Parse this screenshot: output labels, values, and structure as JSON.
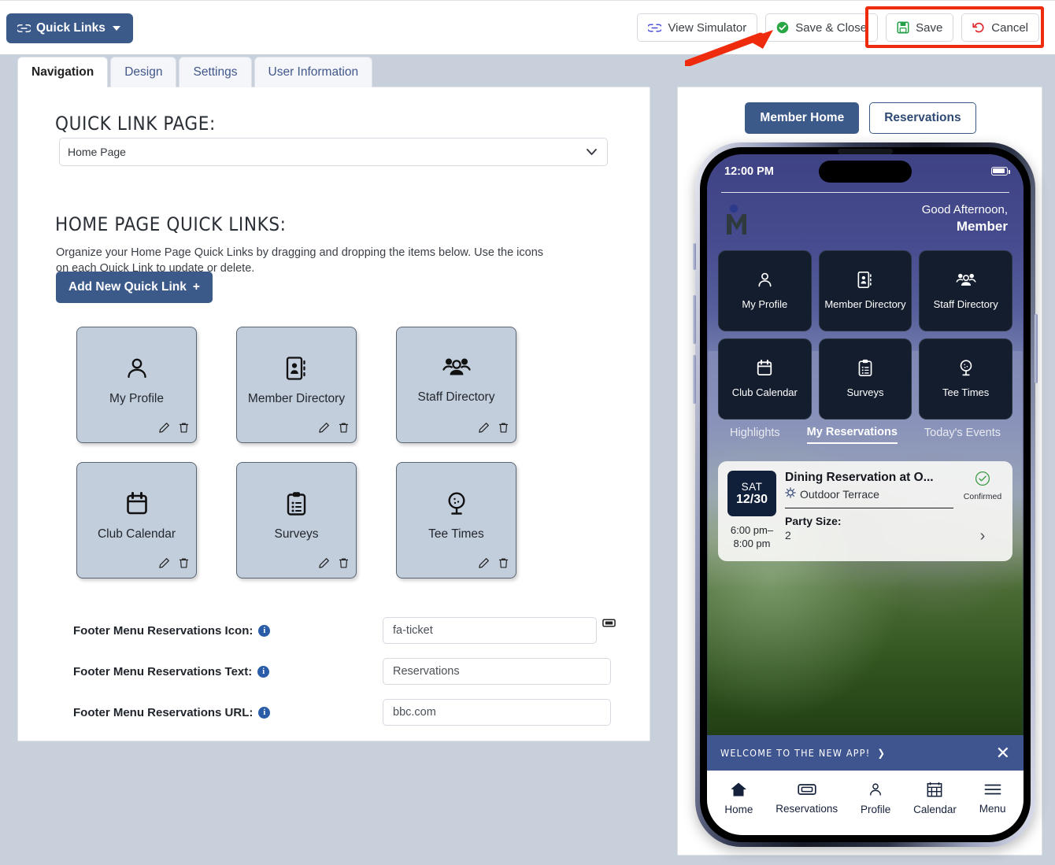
{
  "topbar": {
    "quick_links_button": "Quick Links",
    "view_simulator": "View Simulator",
    "save_and_close": "Save & Close",
    "save": "Save",
    "cancel": "Cancel",
    "highlight_color": "#ef2b0d",
    "accent_color": "#3c5a89"
  },
  "tabs": [
    {
      "label": "Navigation",
      "active": true
    },
    {
      "label": "Design",
      "active": false
    },
    {
      "label": "Settings",
      "active": false
    },
    {
      "label": "User Information",
      "active": false
    }
  ],
  "left_panel": {
    "quick_link_page_heading": "QUICK LINK PAGE:",
    "page_select_value": "Home Page",
    "home_page_heading": "HOME PAGE QUICK LINKS:",
    "description": "Organize your Home Page Quick Links by dragging and dropping the items below. Use the icons on each Quick Link to update or delete.",
    "add_button": "Add New Quick Link",
    "add_button_plus": "+",
    "tiles": [
      {
        "label": "My Profile",
        "icon": "person-icon"
      },
      {
        "label": "Member Directory",
        "icon": "address-book-icon"
      },
      {
        "label": "Staff Directory",
        "icon": "people-group-icon"
      },
      {
        "label": "Club Calendar",
        "icon": "calendar-icon"
      },
      {
        "label": "Surveys",
        "icon": "clipboard-list-icon"
      },
      {
        "label": "Tee Times",
        "icon": "golf-ball-icon"
      }
    ],
    "footer_fields": [
      {
        "label": "Footer Menu Reservations Icon:",
        "value": "fa-ticket",
        "has_preview_icon": true
      },
      {
        "label": "Footer Menu Reservations Text:",
        "value": "Reservations",
        "has_preview_icon": false
      },
      {
        "label": "Footer Menu Reservations URL:",
        "value": "bbc.com",
        "has_preview_icon": false
      }
    ]
  },
  "right_panel": {
    "segmented": [
      {
        "label": "Member Home",
        "active": true
      },
      {
        "label": "Reservations",
        "active": false
      }
    ],
    "phone": {
      "status_time": "12:00 PM",
      "greeting_line1": "Good Afternoon,",
      "greeting_line2": "Member",
      "tiles": [
        {
          "label": "My Profile",
          "icon": "person-icon"
        },
        {
          "label": "Member Directory",
          "icon": "address-book-icon"
        },
        {
          "label": "Staff Directory",
          "icon": "people-group-icon"
        },
        {
          "label": "Club Calendar",
          "icon": "calendar-icon"
        },
        {
          "label": "Surveys",
          "icon": "clipboard-list-icon"
        },
        {
          "label": "Tee Times",
          "icon": "golf-ball-icon"
        }
      ],
      "content_tabs": [
        {
          "label": "Highlights",
          "active": false
        },
        {
          "label": "My Reservations",
          "active": true
        },
        {
          "label": "Today's Events",
          "active": false
        }
      ],
      "reservation": {
        "day": "SAT",
        "date": "12/30",
        "time": "6:00 pm–\n8:00 pm",
        "time_line1": "6:00 pm–",
        "time_line2": "8:00 pm",
        "title": "Dining Reservation at O...",
        "location": "Outdoor Terrace",
        "party_label": "Party Size:",
        "party_value": "2",
        "status": "Confirmed",
        "status_color": "#3f9c46"
      },
      "banner_text": "WELCOME TO THE NEW APP!",
      "nav_items": [
        {
          "label": "Home",
          "icon": "home-icon",
          "active": true
        },
        {
          "label": "Reservations",
          "icon": "ticket-icon",
          "active": false
        },
        {
          "label": "Profile",
          "icon": "person-icon",
          "active": false
        },
        {
          "label": "Calendar",
          "icon": "calendar-grid-icon",
          "active": false
        },
        {
          "label": "Menu",
          "icon": "hamburger-icon",
          "active": false
        }
      ]
    }
  }
}
